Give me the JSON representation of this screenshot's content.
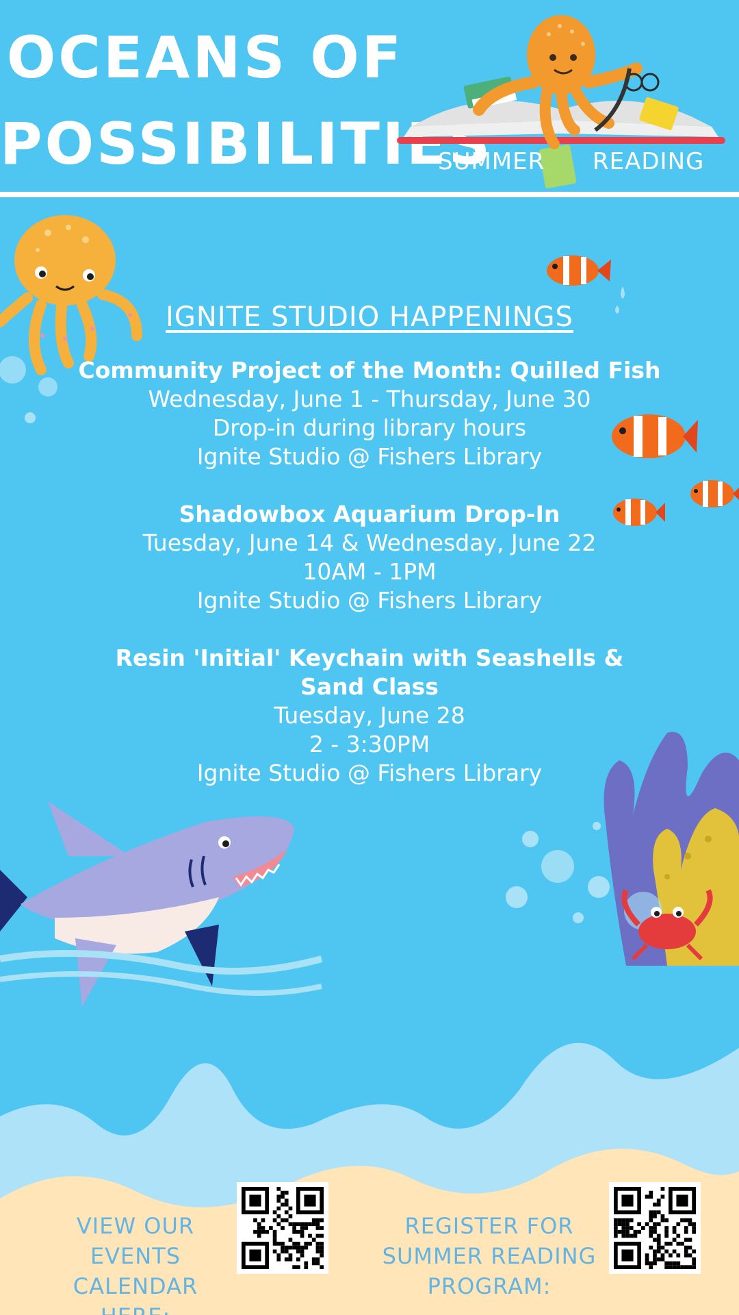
{
  "header": {
    "title_line_1": "OCEANS OF",
    "title_line_2": "POSSIBILITIES",
    "badge_left": "SUMMER",
    "badge_right": "READING"
  },
  "section": {
    "heading": "IGNITE STUDIO HAPPENINGS"
  },
  "events": [
    {
      "title": "Community Project of the Month: Quilled Fish",
      "lines": [
        "Wednesday, June 1 - Thursday, June 30",
        "Drop-in during library hours",
        "Ignite Studio @ Fishers Library"
      ]
    },
    {
      "title": "Shadowbox Aquarium Drop-In",
      "lines": [
        "Tuesday, June 14 & Wednesday, June 22",
        "10AM - 1PM",
        "Ignite Studio @ Fishers Library"
      ]
    },
    {
      "title": "Resin 'Initial' Keychain with Seashells & Sand Class",
      "lines": [
        "Tuesday, June 28",
        "2 - 3:30PM",
        "Ignite Studio @ Fishers Library"
      ]
    }
  ],
  "footer": {
    "calendar_label": "VIEW OUR EVENTS CALENDAR HERE:",
    "register_label": "REGISTER FOR SUMMER READING PROGRAM:"
  },
  "colors": {
    "background": "#4fc6f2",
    "sand": "#ffe5b8",
    "wave_light": "#aee2f8",
    "cta_text": "#62b4e4",
    "octopus": "#f6b03c"
  }
}
